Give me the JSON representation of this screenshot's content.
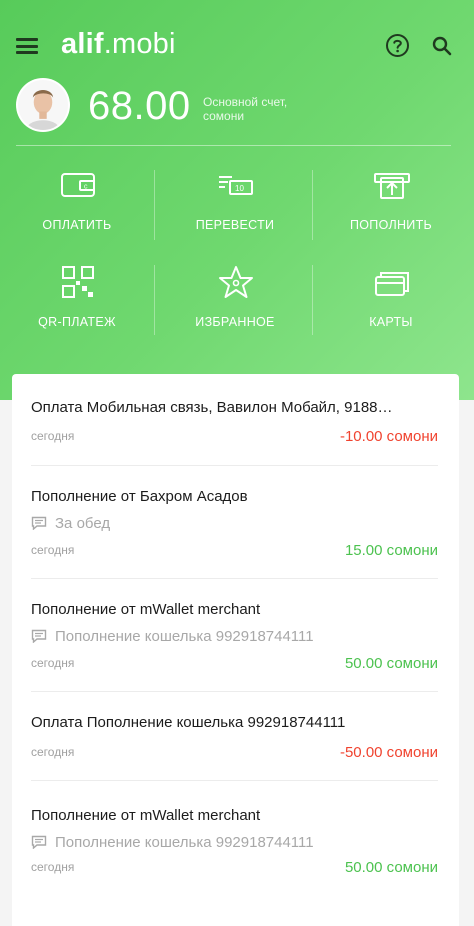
{
  "app": {
    "brand_bold": "alif",
    "brand_light": ".mobi"
  },
  "account": {
    "balance": "68.00",
    "label": "Основной счет, сомони"
  },
  "actions": [
    {
      "label": "ОПЛАТИТЬ",
      "icon": "wallet-icon"
    },
    {
      "label": "ПЕРЕВЕСТИ",
      "icon": "transfer-icon"
    },
    {
      "label": "ПОПОЛНИТЬ",
      "icon": "topup-icon"
    },
    {
      "label": "QR-ПЛАТЕЖ",
      "icon": "qr-icon"
    },
    {
      "label": "ИЗБРАННОЕ",
      "icon": "star-icon"
    },
    {
      "label": "КАРТЫ",
      "icon": "cards-icon"
    }
  ],
  "transactions": [
    {
      "title": "Оплата Мобильная связь, Вавилон Мобайл, 9188…",
      "comment": "",
      "date": "сегодня",
      "amount": "-10.00 сомони",
      "type": "negative"
    },
    {
      "title": "Пополнение от Бахром Асадов",
      "comment": "За обед",
      "date": "сегодня",
      "amount": "15.00 сомони",
      "type": "positive"
    },
    {
      "title": "Пополнение от mWallet merchant",
      "comment": "Пополнение кошелька 992918744111",
      "date": "сегодня",
      "amount": "50.00 сомони",
      "type": "positive"
    },
    {
      "title": "Оплата Пополнение кошелька 992918744111",
      "comment": "",
      "date": "сегодня",
      "amount": "-50.00 сомони",
      "type": "negative"
    },
    {
      "title": "Пополнение от mWallet merchant",
      "comment": "Пополнение кошелька 992918744111",
      "date": "сегодня",
      "amount": "50.00 сомони",
      "type": "positive"
    }
  ],
  "colors": {
    "header_green": "#5fcf61",
    "negative": "#f0432f",
    "positive": "#4cc24f"
  }
}
